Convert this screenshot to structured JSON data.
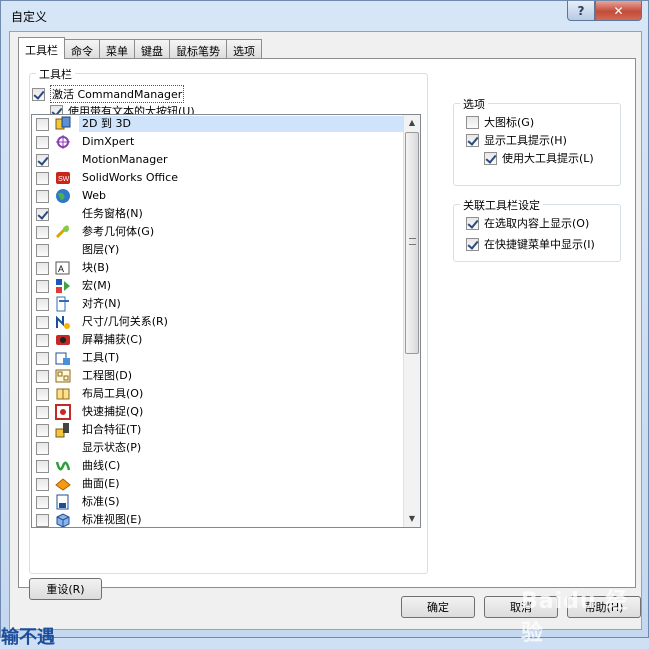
{
  "window": {
    "title": "自定义",
    "help_glyph": "?",
    "close_glyph": "✕"
  },
  "tabs": [
    {
      "label": "工具栏",
      "active": true
    },
    {
      "label": "命令"
    },
    {
      "label": "菜单"
    },
    {
      "label": "键盘"
    },
    {
      "label": "鼠标笔势"
    },
    {
      "label": "选项"
    }
  ],
  "toolbars_group": {
    "label": "工具栏",
    "activate_cm": {
      "label": "激活 CommandManager",
      "checked": true
    },
    "large_buttons": {
      "label": "使用带有文本的大按钮(U)",
      "checked": true
    },
    "items": [
      {
        "label": "2D 到 3D",
        "checked": false,
        "icon": "2d-to-3d-icon",
        "selected": true
      },
      {
        "label": "DimXpert",
        "checked": false,
        "icon": "dimxpert-icon"
      },
      {
        "label": "MotionManager",
        "checked": true,
        "icon": ""
      },
      {
        "label": "SolidWorks Office",
        "checked": false,
        "icon": "solidworks-office-icon"
      },
      {
        "label": "Web",
        "checked": false,
        "icon": "globe-icon"
      },
      {
        "label": "任务窗格(N)",
        "checked": true,
        "icon": ""
      },
      {
        "label": "参考几何体(G)",
        "checked": false,
        "icon": "reference-geometry-icon"
      },
      {
        "label": "图层(Y)",
        "checked": false,
        "icon": ""
      },
      {
        "label": "块(B)",
        "checked": false,
        "icon": "block-icon"
      },
      {
        "label": "宏(M)",
        "checked": false,
        "icon": "macro-icon"
      },
      {
        "label": "对齐(N)",
        "checked": false,
        "icon": "align-icon"
      },
      {
        "label": "尺寸/几何关系(R)",
        "checked": false,
        "icon": "dimension-icon"
      },
      {
        "label": "屏幕捕获(C)",
        "checked": false,
        "icon": "screen-capture-icon"
      },
      {
        "label": "工具(T)",
        "checked": false,
        "icon": "tools-icon"
      },
      {
        "label": "工程图(D)",
        "checked": false,
        "icon": "drawing-icon"
      },
      {
        "label": "布局工具(O)",
        "checked": false,
        "icon": "layout-tools-icon"
      },
      {
        "label": "快速捕捉(Q)",
        "checked": false,
        "icon": "quick-snap-icon"
      },
      {
        "label": "扣合特征(T)",
        "checked": false,
        "icon": "fastening-features-icon"
      },
      {
        "label": "显示状态(P)",
        "checked": false,
        "icon": ""
      },
      {
        "label": "曲线(C)",
        "checked": false,
        "icon": "curves-icon"
      },
      {
        "label": "曲面(E)",
        "checked": false,
        "icon": "surfaces-icon"
      },
      {
        "label": "标准(S)",
        "checked": false,
        "icon": "standard-icon"
      },
      {
        "label": "标准视图(E)",
        "checked": false,
        "icon": "standard-views-icon"
      }
    ]
  },
  "options_group": {
    "label": "选项",
    "large_icons": {
      "label": "大图标(G)",
      "checked": false
    },
    "show_tooltips": {
      "label": "显示工具提示(H)",
      "checked": true
    },
    "large_tooltips": {
      "label": "使用大工具提示(L)",
      "checked": true
    }
  },
  "context_group": {
    "label": "关联工具栏设定",
    "show_on_selection": {
      "label": "在选取内容上显示(O)",
      "checked": true
    },
    "show_in_shortcut": {
      "label": "在快捷键菜单中显示(I)",
      "checked": true
    }
  },
  "buttons": {
    "reset": "重设(R)",
    "ok": "确定",
    "cancel": "取消",
    "help": "帮助(H)"
  },
  "watermark": {
    "right": "Baidu 经验",
    "left": "输不遇"
  }
}
